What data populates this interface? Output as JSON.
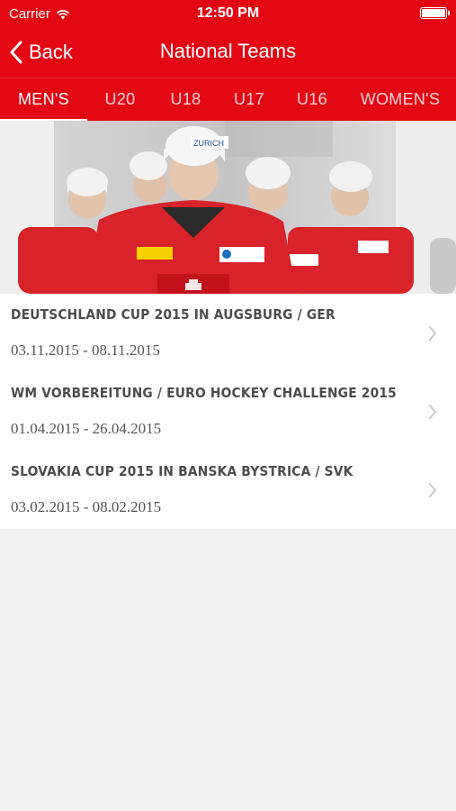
{
  "status_bar": {
    "carrier": "Carrier",
    "time": "12:50 PM"
  },
  "nav": {
    "back_label": "Back",
    "title": "National Teams"
  },
  "tabs": [
    {
      "label": "MEN'S",
      "active": true
    },
    {
      "label": "U20",
      "active": false
    },
    {
      "label": "U18",
      "active": false
    },
    {
      "label": "U17",
      "active": false
    },
    {
      "label": "U16",
      "active": false
    },
    {
      "label": "WOMEN'S",
      "active": false
    }
  ],
  "hero": {
    "sponsor_label": "ZURICH"
  },
  "events": [
    {
      "title": "DEUTSCHLAND CUP 2015 IN AUGSBURG / GER",
      "dates": "03.11.2015 - 08.11.2015"
    },
    {
      "title": "WM VORBEREITUNG / EURO HOCKEY CHALLENGE 2015",
      "dates": "01.04.2015 - 26.04.2015"
    },
    {
      "title": "SLOVAKIA CUP 2015 IN BANSKA BYSTRICA / SVK",
      "dates": "03.02.2015 - 08.02.2015"
    }
  ],
  "colors": {
    "brand_red": "#e30613",
    "background": "#f2f2f2",
    "text_dark": "#4d4d4d"
  },
  "icons": {
    "back": "chevron-left-icon",
    "row": "chevron-right-icon",
    "wifi": "wifi-icon",
    "battery": "battery-icon"
  }
}
